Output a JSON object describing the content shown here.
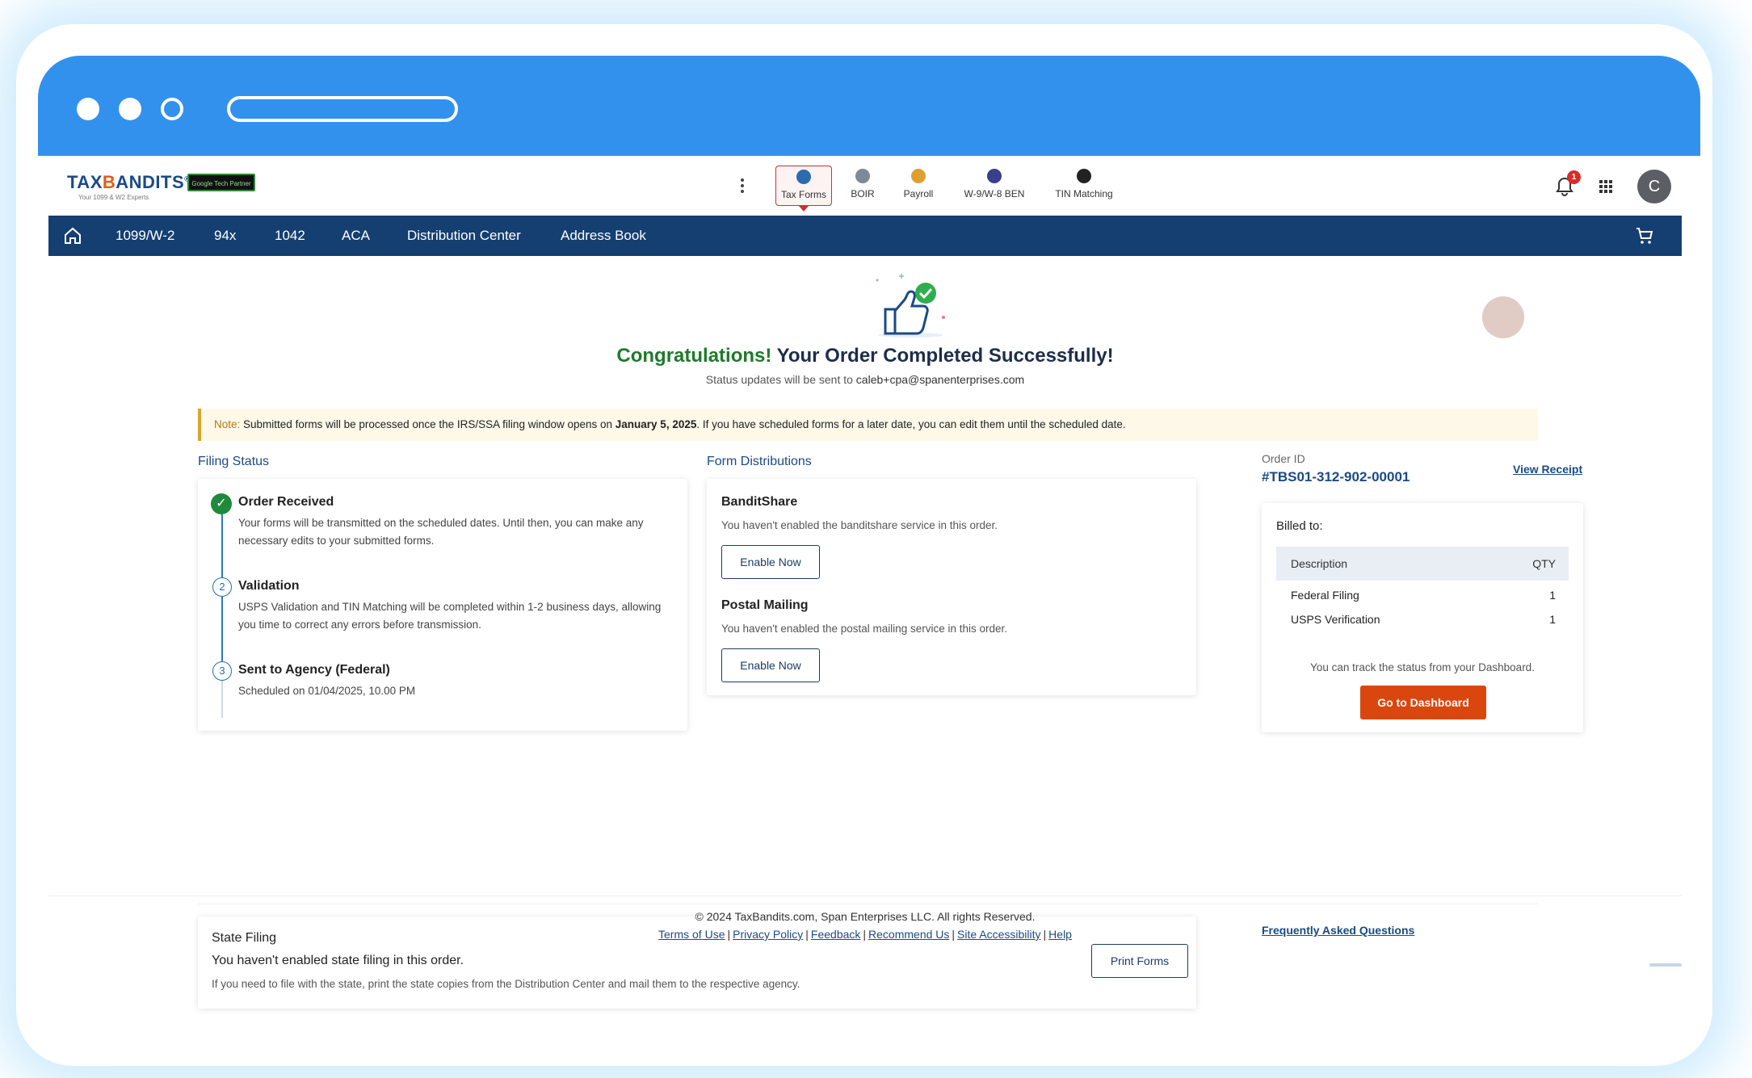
{
  "browser": {
    "controls": [
      "close",
      "minimize",
      "maximize"
    ]
  },
  "brand": {
    "logo_left": "TAX",
    "logo_mid": "B",
    "logo_right": "ANDITS",
    "logo_reg": "®",
    "tagline": "Your 1099 & W2 Experts",
    "partner_badge": "Google Tech Partner"
  },
  "products": [
    {
      "label": "Tax Forms",
      "color": "#2b6cb0",
      "active": true
    },
    {
      "label": "BOIR",
      "color": "#7a8a99"
    },
    {
      "label": "Payroll",
      "color": "#e0a030"
    },
    {
      "label": "W-9/W-8 BEN",
      "color": "#3a3f8a"
    },
    {
      "label": "TIN Matching",
      "color": "#222222"
    }
  ],
  "notifications": {
    "count": "1"
  },
  "user": {
    "initial": "C"
  },
  "nav": {
    "items": [
      "1099/W-2",
      "94x",
      "1042",
      "ACA",
      "Distribution Center",
      "Address Book"
    ]
  },
  "hero": {
    "congrats": "Congratulations!",
    "headline": " Your Order Completed Successfully!",
    "status_prefix": "Status updates will be sent to ",
    "email": "caleb+cpa@spanenterprises.com"
  },
  "note": {
    "label": "Note:",
    "text_before": " Submitted forms will be processed once the IRS/SSA filing window opens on ",
    "date": "January 5, 2025",
    "text_after": ". If you have scheduled forms for a later date, you can edit them until the scheduled date."
  },
  "filing_status": {
    "title": "Filing Status",
    "steps": [
      {
        "num": "✓",
        "title": "Order Received",
        "desc": "Your forms will be transmitted on the scheduled dates. Until then, you can make any necessary edits to your submitted forms."
      },
      {
        "num": "2",
        "title": "Validation",
        "desc": "USPS Validation and TIN Matching will be completed within 1-2 business days, allowing you time to correct any errors before transmission."
      },
      {
        "num": "3",
        "title": "Sent to Agency (Federal)",
        "desc": "Scheduled on 01/04/2025, 10.00 PM"
      }
    ]
  },
  "form_distributions": {
    "title": "Form Distributions",
    "items": [
      {
        "title": "BanditShare",
        "desc": "You haven't enabled the banditshare service in this order.",
        "button": "Enable Now"
      },
      {
        "title": "Postal Mailing",
        "desc": "You haven't enabled the postal mailing service in this order.",
        "button": "Enable Now"
      }
    ]
  },
  "order": {
    "id_label": "Order ID",
    "id": "#TBS01-312-902-00001",
    "view_receipt": "View Receipt",
    "billed_to": "Billed to:",
    "columns": [
      "Description",
      "QTY"
    ],
    "rows": [
      {
        "description": "Federal Filing",
        "qty": "1"
      },
      {
        "description": "USPS Verification",
        "qty": "1"
      }
    ],
    "track_text": "You can track the status from your Dashboard.",
    "dashboard_button": "Go to Dashboard"
  },
  "state_filing": {
    "title": "State Filing",
    "subtitle": "You haven't enabled state filing in this order.",
    "desc": "If you need to file with the state, print the state copies from the Distribution Center and mail them to the respective agency.",
    "button": "Print Forms"
  },
  "faq": "Frequently Asked Questions",
  "footer": {
    "copyright": "© 2024 TaxBandits.com, Span Enterprises LLC. All rights Reserved.",
    "links": [
      "Terms of Use",
      "Privacy Policy",
      "Feedback",
      "Recommend Us",
      "Site Accessibility",
      "Help"
    ]
  }
}
